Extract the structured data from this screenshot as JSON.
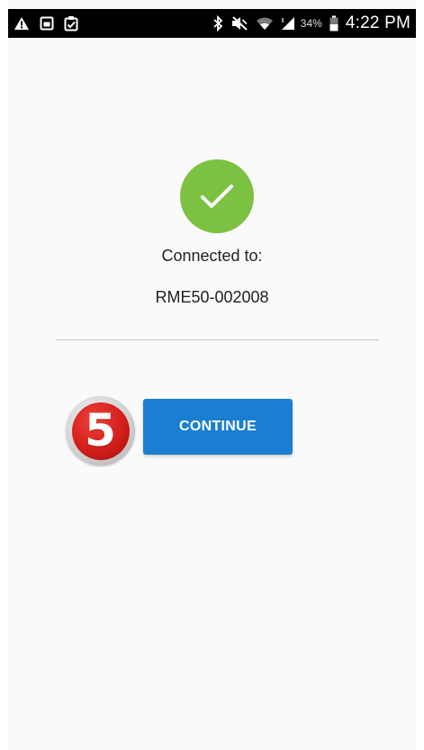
{
  "status_bar": {
    "icons_left": [
      "warning-icon",
      "image-icon",
      "clipboard-check-icon"
    ],
    "icons_right": [
      "bluetooth-icon",
      "mute-icon",
      "wifi-icon",
      "signal-icon",
      "battery-icon"
    ],
    "battery_percent": "34%",
    "time": "4:22 PM"
  },
  "connection": {
    "status_icon": "check-icon",
    "status_color": "#7cc142",
    "label": "Connected to:",
    "device_name": "RME50-002008"
  },
  "actions": {
    "continue_label": "CONTINUE",
    "continue_color": "#1a7fd0"
  },
  "annotation": {
    "step_number": "5",
    "badge_color": "#d21f1b"
  }
}
